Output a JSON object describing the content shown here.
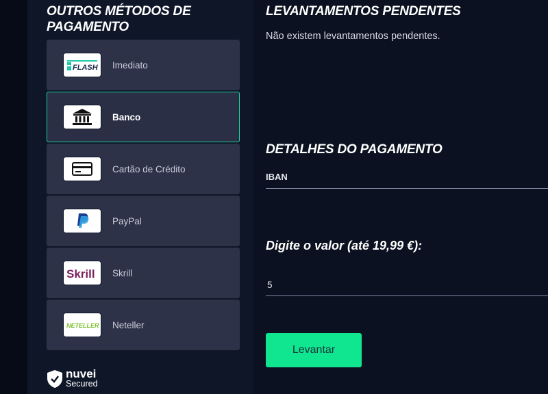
{
  "payment_methods": {
    "title": "OUTROS MÉTODOS DE PAGAMENTO",
    "items": [
      {
        "label": "Imediato",
        "logo": "flash-logo",
        "logo_text": "FLASH",
        "selected": false
      },
      {
        "label": "Banco",
        "logo": "bank-icon",
        "selected": true
      },
      {
        "label": "Cartão de Crédito",
        "logo": "credit-card-icon",
        "selected": false
      },
      {
        "label": "PayPal",
        "logo": "paypal-logo",
        "selected": false
      },
      {
        "label": "Skrill",
        "logo": "skrill-logo",
        "logo_text": "Skrill",
        "selected": false
      },
      {
        "label": "Neteller",
        "logo": "neteller-logo",
        "logo_text": "NETELLER",
        "selected": false
      }
    ]
  },
  "secured_badge": {
    "name": "nuvei",
    "sub": "Secured"
  },
  "pending": {
    "title": "LEVANTAMENTOS PENDENTES",
    "message": "Não existem levantamentos pendentes."
  },
  "details": {
    "title": "DETALHES DO PAGAMENTO",
    "iban_label": "IBAN"
  },
  "amount": {
    "label": "Digite o valor (até 19,99 €):",
    "value": "5"
  },
  "withdraw_button": "Levantar",
  "colors": {
    "accent": "#1fd7a0",
    "button": "#10e68f",
    "card_bg": "#2d3249",
    "page_bg": "#0b1120"
  }
}
